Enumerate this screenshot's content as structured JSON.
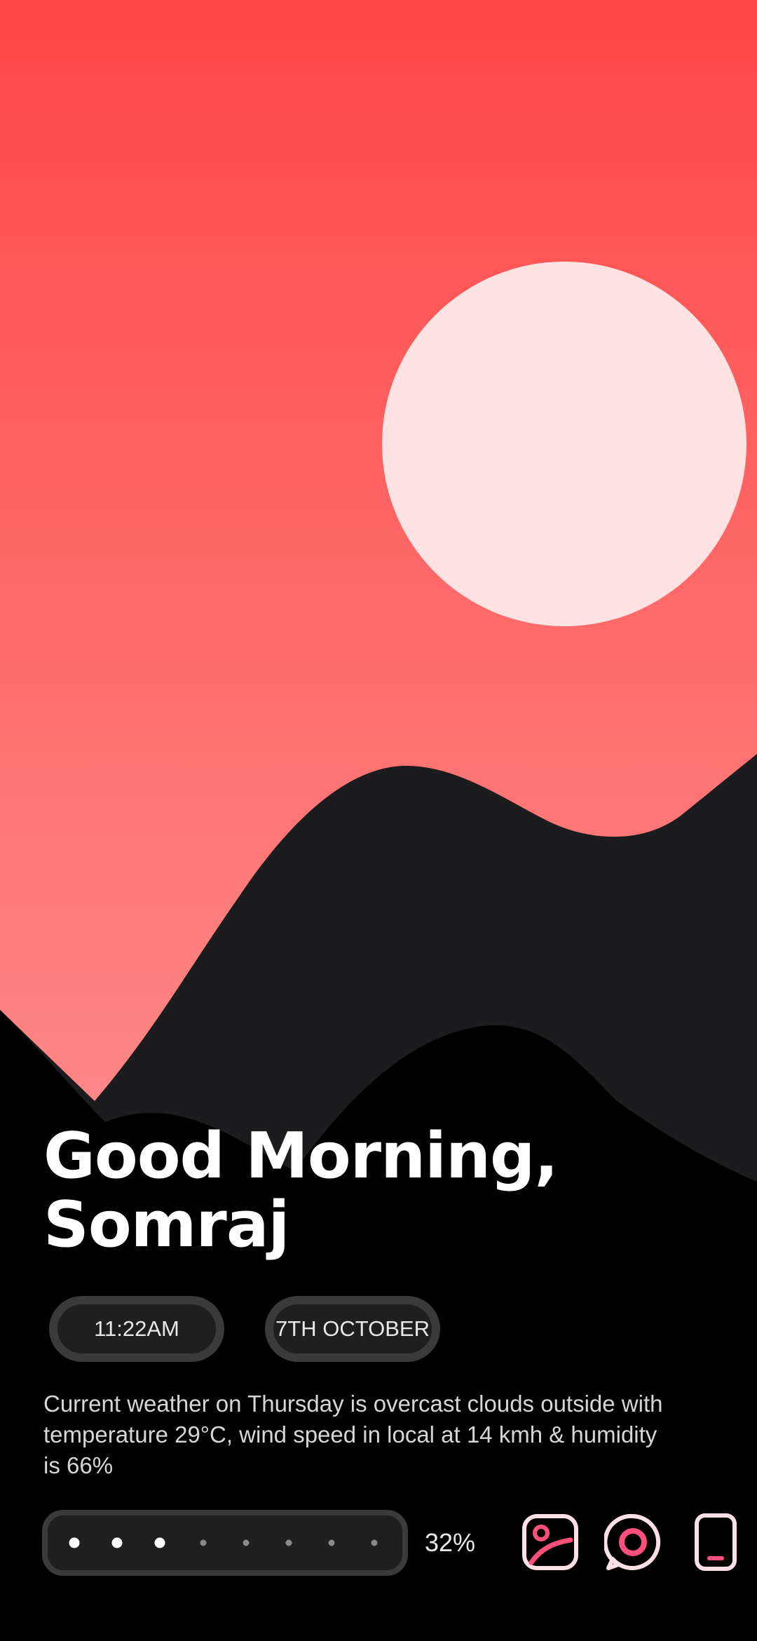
{
  "greeting": {
    "line1": "Good Morning,",
    "line2": "Somraj"
  },
  "status": {
    "time": "11:22AM",
    "date": "7TH OCTOBER"
  },
  "weather_summary": "Current weather on Thursday is overcast clouds outside with temperature 29°C, wind speed in local at 14 kmh & humidity is 66%",
  "battery": {
    "percent_label": "32%",
    "level": 0.32,
    "dots_total": 8,
    "dots_filled": 3
  },
  "dock_icons": [
    {
      "name": "gallery-icon"
    },
    {
      "name": "chat-icon"
    },
    {
      "name": "phone-icon"
    }
  ],
  "colors": {
    "sky_top": "#ff4747",
    "sky_bottom": "#ff8a8a",
    "sun": "#ffe2e2",
    "mountain_far": "#1c1c1e",
    "mountain_near": "#000000",
    "accent_pink": "#ff4f7b",
    "icon_outline": "#ffe0e6"
  }
}
